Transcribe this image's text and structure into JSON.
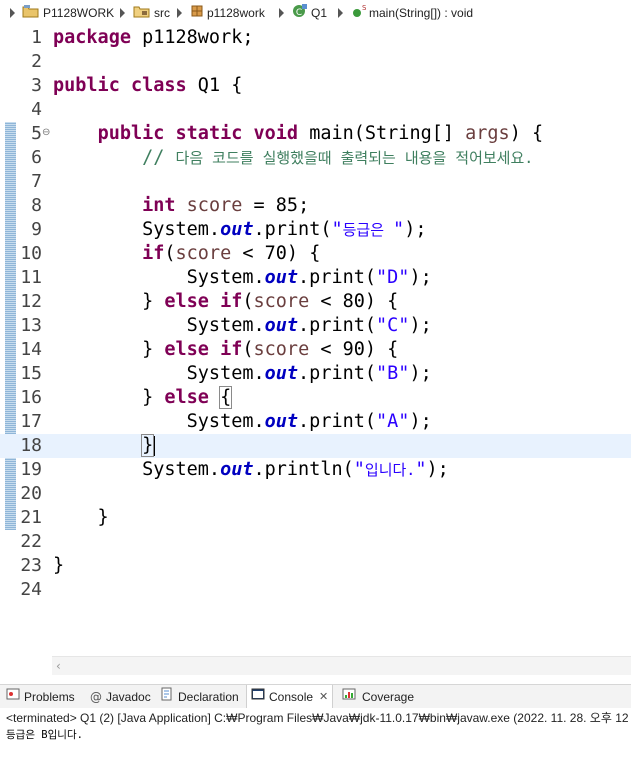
{
  "breadcrumb": {
    "project": "P1128WORK",
    "folder": "src",
    "package": "p1128work",
    "class": "Q1",
    "method": "main(String[]) : void"
  },
  "editor": {
    "line_numbers": [
      "1",
      "2",
      "3",
      "4",
      "5",
      "6",
      "7",
      "8",
      "9",
      "10",
      "11",
      "12",
      "13",
      "14",
      "15",
      "16",
      "17",
      "18",
      "19",
      "20",
      "21",
      "22",
      "23",
      "24"
    ],
    "current_line": "18"
  },
  "views": {
    "tabs": [
      {
        "label": "Problems",
        "icon": "problems-icon"
      },
      {
        "label": "Javadoc",
        "icon": "at-icon"
      },
      {
        "label": "Declaration",
        "icon": "declaration-icon"
      },
      {
        "label": "Console",
        "icon": "console-icon",
        "active": true
      },
      {
        "label": "Coverage",
        "icon": "coverage-icon"
      }
    ]
  },
  "console": {
    "terminated_text": "<terminated> Q1 (2) [Java Application] C:₩Program Files₩Java₩jdk-11.0.17₩bin₩javaw.exe  (2022. 11. 28. 오후 12",
    "output": "등급은 B입니다."
  }
}
